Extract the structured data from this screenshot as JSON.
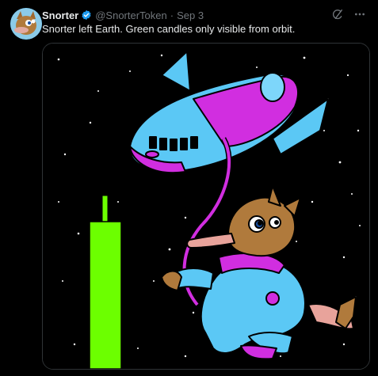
{
  "tweet": {
    "author_name": "Snorter",
    "handle": "@SnorterToken",
    "separator": "·",
    "date": "Sep 3",
    "text": "Snorter left Earth. Green candles only visible from orbit."
  },
  "icons": {
    "verified": "verified-badge-icon",
    "grok": "grok-icon",
    "more": "more-icon"
  },
  "colors": {
    "verified": "#1d9bf0",
    "candle": "#6cff00",
    "ship_body": "#5bc8f5",
    "ship_accent": "#d12ee0",
    "creature_fur": "#b07a3c"
  }
}
